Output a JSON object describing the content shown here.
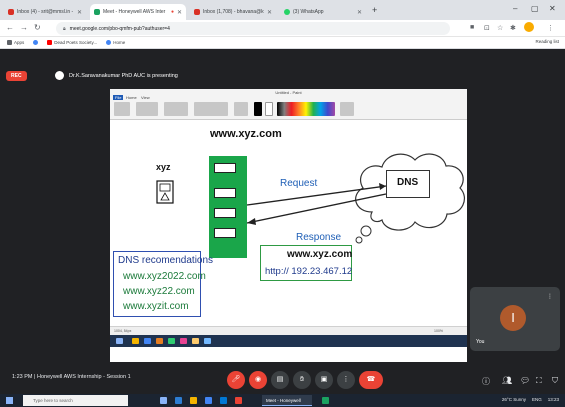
{
  "browser": {
    "tabs": [
      {
        "label": "Inbox (4) - srit@mmsl.in - SRIT.i",
        "favicon_color": "#d93025"
      },
      {
        "label": "Meet - Honeywell AWS Inter",
        "favicon_color": "#1aa260",
        "active": true
      },
      {
        "label": "Inbox (1,708) - bhavana@ktm",
        "favicon_color": "#d93025"
      },
      {
        "label": "(3) WhatsApp",
        "favicon_color": "#25d366"
      }
    ],
    "new_tab": "+",
    "url": "meet.google.com/pbo-qmfm-pub?authuser=4",
    "bookmarks": [
      "Apps",
      "Dead Poets Society...",
      "Home"
    ],
    "reading_list": "Reading list"
  },
  "meet": {
    "rec_label": "REC",
    "presenter": "Dr.K.Saravanakumar PhD AUC is presenting",
    "time": "1:23 PM",
    "separator": "|",
    "meeting_name": "Honeywell AWS Internship - Session 1",
    "participant_initial": "I",
    "participant_name": "You"
  },
  "shared_screen": {
    "app_title": "Untitled - Paint",
    "ribbon_tabs": [
      "File",
      "Home",
      "View"
    ],
    "diagram": {
      "site": "www.xyz.com",
      "client_label": "xyz",
      "dns_label": "DNS",
      "request_label": "Request",
      "response_label": "Response",
      "response_line1": "www.xyz.com",
      "response_line2": "http:// 192.23.467.12",
      "recommendations_title": "DNS recomendations",
      "recommendations": [
        "www.xyz2022.com",
        "www.xyz22.com",
        "www.xyzit.com"
      ]
    },
    "status_text": "1004, 54px",
    "zoom": "100%"
  },
  "taskbar": {
    "search_placeholder": "Type here to search",
    "active_app": "Meet - Honeywell",
    "weather": "26°C Sunny",
    "lang": "ENG",
    "clock": "13:23"
  },
  "colors": {
    "accent_red": "#ea4335",
    "server_green": "#1aa64a",
    "dns_blue": "#1f3a8c"
  }
}
